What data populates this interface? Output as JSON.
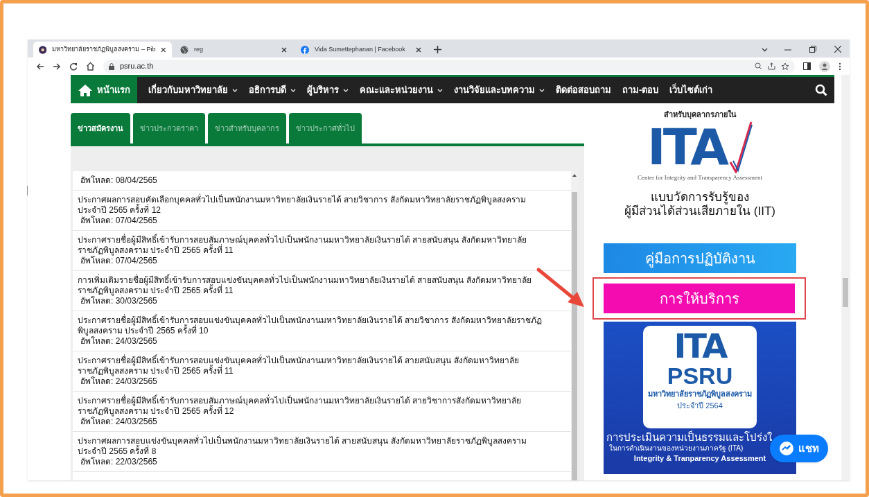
{
  "browser": {
    "tabs": [
      {
        "title": "มหาวิทยาลัยราชภัฏพิบูลสงคราม – Pib",
        "kind": "site",
        "selected": true
      },
      {
        "title": "reg",
        "kind": "globe",
        "selected": false
      },
      {
        "title": "Vida Sumettephanan | Facebook",
        "kind": "facebook",
        "selected": false
      }
    ],
    "url": "psru.ac.th"
  },
  "nav": [
    {
      "label": "หน้าแรก",
      "dropdown": false,
      "selected": true
    },
    {
      "label": "เกี่ยวกับมหาวิทยาลัย",
      "dropdown": true,
      "selected": false
    },
    {
      "label": "อธิการบดี",
      "dropdown": true,
      "selected": false
    },
    {
      "label": "ผู้บริหาร",
      "dropdown": true,
      "selected": false
    },
    {
      "label": "คณะและหน่วยงาน",
      "dropdown": true,
      "selected": false
    },
    {
      "label": "งานวิจัยและบทความ",
      "dropdown": true,
      "selected": false
    },
    {
      "label": "ติดต่อสอบถาม",
      "dropdown": false,
      "selected": false
    },
    {
      "label": "ถาม-ตอบ",
      "dropdown": false,
      "selected": false
    },
    {
      "label": "เว็บไซต์เก่า",
      "dropdown": false,
      "selected": false
    }
  ],
  "news_tabs": [
    {
      "label": "ข่าวสมัครงาน",
      "selected": true
    },
    {
      "label": "ข่าวประกวดราคา",
      "selected": false
    },
    {
      "label": "ข่าวสำหรับบุคลากร",
      "selected": false
    },
    {
      "label": "ข่าวประกาศทั่วไป",
      "selected": false
    }
  ],
  "news": [
    {
      "uploaded": "อัพโหลด: 08/04/2565"
    },
    {
      "text": "ประกาศผลการสอบคัดเลือกบุคคลทั่วไปเป็นพนักงานมหาวิทยาลัยเงินรายได้ สายวิชาการ สังกัดมหาวิทยาลัยราชภัฏพิบูลสงคราม ประจำปี 2565 ครั้งที่ 12",
      "uploaded": "อัพโหลด: 07/04/2565"
    },
    {
      "text": "ประกาศรายชื่อผู้มีสิทธิ์เข้ารับการสอบสัมภาษณ์บุคคลทั่วไปเป็นพนักงานมหาวิทยาลัยเงินรายได้ สายสนับสนุน สังกัดมหาวิทยาลัยราชภัฏพิบูลสงคราม ประจำปี 2565 ครั้งที่ 11",
      "uploaded": "อัพโหลด: 07/04/2565"
    },
    {
      "text": "การเพิ่มเติมรายชื่อผู้มีสิทธิ์เข้ารับการสอบแข่งขันบุคคลทั่วไปเป็นพนักงานมหาวิทยาลัยเงินรายได้ สายสนับสนุน สังกัดมหาวิทยาลัยราชภัฏพิบูลสงคราม ประจำปี 2565 ครั้งที่ 11",
      "uploaded": "อัพโหลด: 30/03/2565"
    },
    {
      "text": "ประกาศรายชื่อผู้มีสิทธิ์เข้ารับการสอบแข่งขันบุคคลทั่วไปเป็นพนักงานมหาวิทยาลัยเงินรายได้ สายวิชาการ สังกัดมหาวิทยาลัยราชภัฏพิบูลสงคราม ประจำปี 2565 ครั้งที่ 10",
      "uploaded": "อัพโหลด: 24/03/2565"
    },
    {
      "text": "ประกาศรายชื่อผู้มีสิทธิ์เข้ารับการสอบแข่งขันบุคคลทั่วไปเป็นพนักงานมหาวิทยาลัยเงินรายได้ สายสนับสนุน สังกัดมหาวิทยาลัยราชภัฏพิบูลสงคราม ประจำปี 2565 ครั้งที่ 11",
      "uploaded": "อัพโหลด: 24/03/2565"
    },
    {
      "text": "ประกาศรายชื่อผู้มีสิทธิ์เข้ารับการสอบสัมภาษณ์บุคคลทั่วไปเป็นพนักงานมหาวิทยาลัยเงินรายได้ สายวิชาการสังกัดมหาวิทยาลัยราชภัฏพิบูลสงคราม ประจำปี 2565 ครั้งที่ 12",
      "uploaded": "อัพโหลด: 24/03/2565"
    },
    {
      "text": "ประกาศผลการสอบแข่งขันบุคคลทั่วไปเป็นพนักงานมหาวิทยาลัยเงินรายได้ สายสนับสนุน สังกัดมหาวิทยาลัยราชภัฏพิบูลสงคราม ประจำปี 2565 ครั้งที่ 8",
      "uploaded": "อัพโหลด: 22/03/2565"
    }
  ],
  "sidebar": {
    "iit_banner": {
      "subtitle": "สำหรับบุคลากรภายใน",
      "logo": "ITA",
      "caption": "Center for Integrity and Transparency Assessment",
      "title_1": "แบบวัดการรับรู้ของ",
      "title_2": "ผู้มีส่วนได้ส่วนเสียภายใน (IIT)"
    },
    "manual_button": "คู่มือการปฏิบัติงาน",
    "service_button": "การให้บริการ",
    "ita_banner": {
      "logo": "ITA",
      "name": "PSRU",
      "university": "มหาวิทยาลัยราชภัฏพิบูลสงคราม",
      "year": "ประจำปี 2564",
      "title": "การประเมินความเป็นธรรมและโปร่งใ",
      "subtitle": "ในการดำเนินงานของหน่วยงานภาครัฐ (ITA)",
      "english": "Integrity & Tranparency Assessment"
    }
  },
  "chat_button": "แชท"
}
